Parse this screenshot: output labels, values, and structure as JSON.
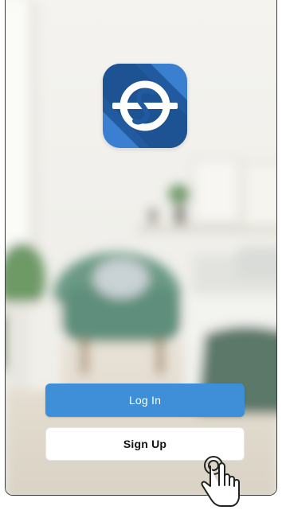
{
  "app": {
    "icon_name": "app-logo-icon",
    "icon_colors": {
      "dark": "#1f4f8f",
      "light": "#3a7fd0"
    }
  },
  "buttons": {
    "login_label": "Log In",
    "signup_label": "Sign Up"
  },
  "colors": {
    "primary": "#3f8fd8",
    "secondary_bg": "#ffffff"
  },
  "gesture": {
    "icon_name": "tap-hand-icon"
  }
}
